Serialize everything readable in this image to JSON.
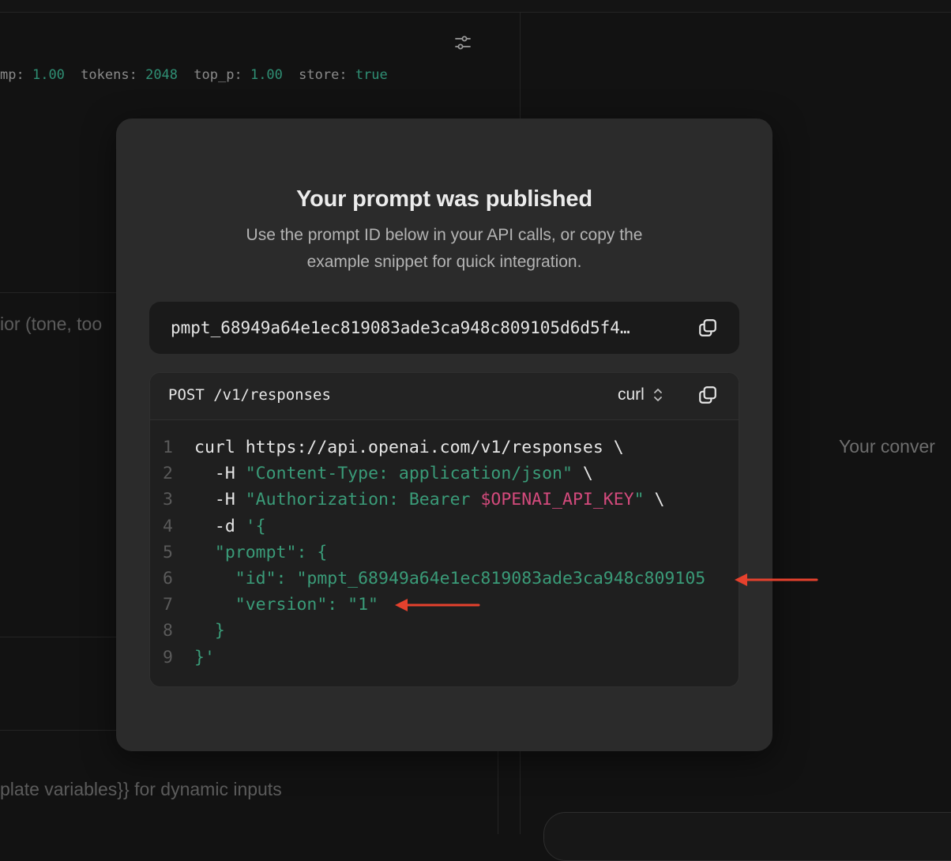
{
  "background": {
    "params": [
      {
        "key": "mp:",
        "value": "1.00"
      },
      {
        "key": "tokens:",
        "value": "2048"
      },
      {
        "key": "top_p:",
        "value": "1.00"
      },
      {
        "key": "store:",
        "value": "true"
      }
    ],
    "instructions_hint": "ior (tone, too",
    "variables_hint": "plate variables}} for dynamic inputs",
    "conversation_hint": "Your conver"
  },
  "modal": {
    "title": "Your prompt was published",
    "subtitle_line1": "Use the prompt ID below in your API calls, or copy the",
    "subtitle_line2": "example snippet for quick integration.",
    "prompt_id": "pmpt_68949a64e1ec819083ade3ca948c809105d6d5f4…",
    "endpoint": "POST /v1/responses",
    "language": "curl",
    "code_lines": [
      {
        "n": "1",
        "text": "curl https://api.openai.com/v1/responses \\"
      },
      {
        "n": "2",
        "text": "  -H \"Content-Type: application/json\" \\"
      },
      {
        "n": "3",
        "text": "  -H \"Authorization: Bearer $OPENAI_API_KEY\" \\"
      },
      {
        "n": "4",
        "text": "  -d '{"
      },
      {
        "n": "5",
        "text": "  \"prompt\": {"
      },
      {
        "n": "6",
        "text": "    \"id\": \"pmpt_68949a64e1ec819083ade3ca948c809105"
      },
      {
        "n": "7",
        "text": "    \"version\": \"1\""
      },
      {
        "n": "8",
        "text": "  }"
      },
      {
        "n": "9",
        "text": "}'"
      }
    ]
  },
  "code_tokens": {
    "l1": "curl https://api.openai.com/v1/responses \\",
    "l2a": "  -H ",
    "l2b": "\"Content-Type: application/json\"",
    "l2c": " \\",
    "l3a": "  -H ",
    "l3b": "\"Authorization: Bearer ",
    "l3c": "$OPENAI_API_KEY",
    "l3d": "\"",
    "l3e": " \\",
    "l4a": "  -d ",
    "l4b": "'{",
    "l5": "  \"prompt\": {",
    "l6": "    \"id\": \"pmpt_68949a64e1ec819083ade3ca948c809105",
    "l7": "    \"version\": \"1\"",
    "l8": "  }",
    "l9": "}'"
  },
  "colors": {
    "accent_green": "#3a9b78",
    "env_pink": "#d34a7c",
    "annotation_arrow": "#e5412d"
  },
  "icons": [
    "settings-sliders-icon",
    "copy-icon",
    "chevron-updown-icon",
    "arrow-left-icon"
  ]
}
